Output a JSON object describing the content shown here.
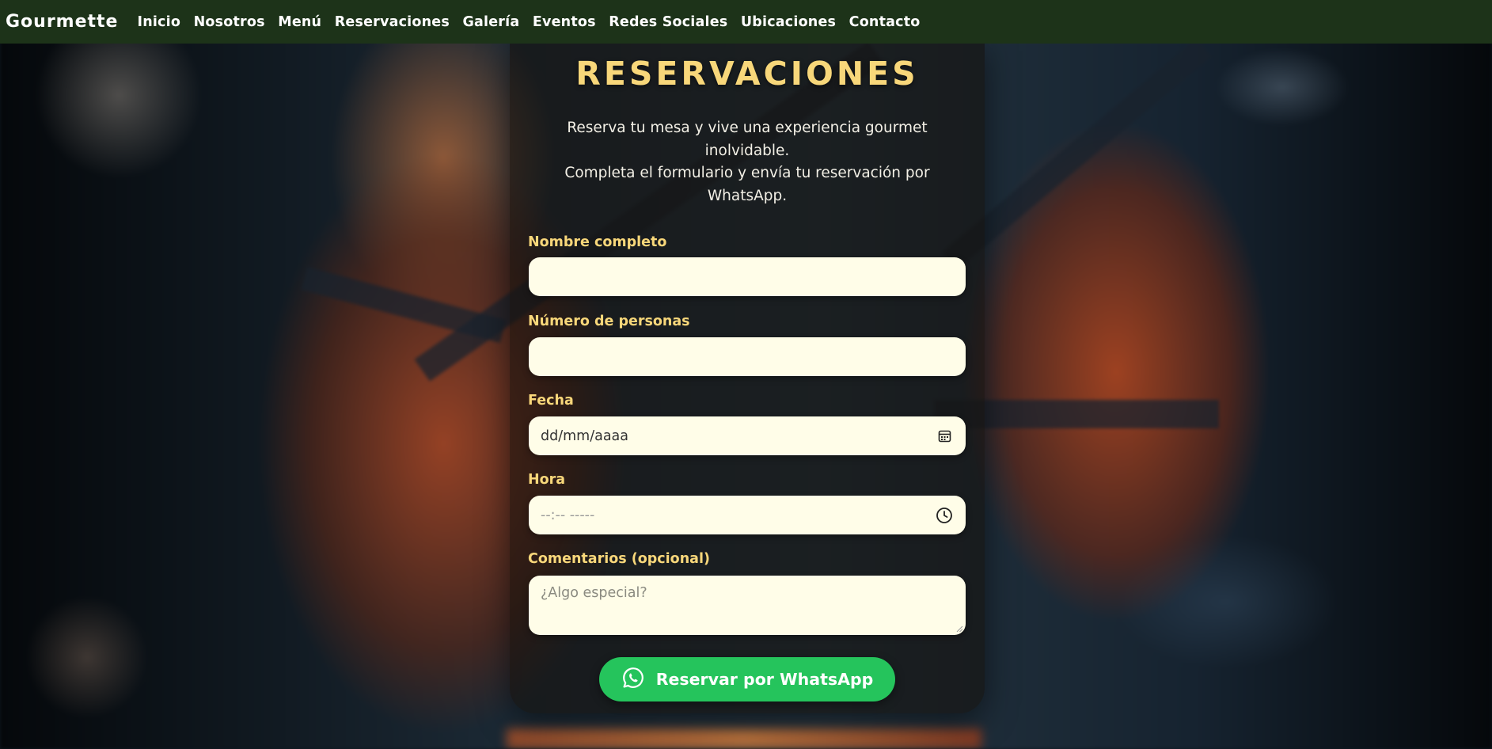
{
  "brand": "Gourmette",
  "nav": {
    "items": [
      "Inicio",
      "Nosotros",
      "Menú",
      "Reservaciones",
      "Galería",
      "Eventos",
      "Redes Sociales",
      "Ubicaciones",
      "Contacto"
    ]
  },
  "reservation": {
    "title": "RESERVACIONES",
    "intro_line1": "Reserva tu mesa y vive una experiencia gourmet inolvidable.",
    "intro_line2": "Completa el formulario y envía tu reservación por WhatsApp.",
    "fields": {
      "name": {
        "label": "Nombre completo",
        "value": ""
      },
      "people": {
        "label": "Número de personas",
        "value": ""
      },
      "date": {
        "label": "Fecha",
        "placeholder": "dd/mm/aaaa",
        "icon": "calendar-icon"
      },
      "time": {
        "label": "Hora",
        "placeholder": "--:-- -----",
        "icon": "clock-icon"
      },
      "comments": {
        "label": "Comentarios (opcional)",
        "placeholder": "¿Algo especial?"
      }
    },
    "submit": {
      "label": "Reservar por WhatsApp",
      "icon": "whatsapp-icon",
      "color": "#25c45c"
    }
  },
  "colors": {
    "navbar": "#1d3319",
    "accent": "#f8d77a",
    "input_bg": "#fffde8"
  }
}
